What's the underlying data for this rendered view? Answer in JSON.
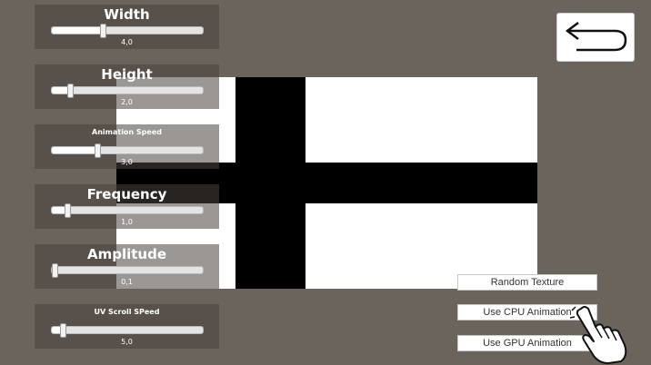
{
  "sliders": [
    {
      "title": "Width",
      "value": "4,0",
      "fraction": 0.34,
      "title_size": "big"
    },
    {
      "title": "Height",
      "value": "2,0",
      "fraction": 0.12,
      "title_size": "big"
    },
    {
      "title": "Animation Speed",
      "value": "3,0",
      "fraction": 0.3,
      "title_size": "small"
    },
    {
      "title": "Frequency",
      "value": "1,0",
      "fraction": 0.1,
      "title_size": "big"
    },
    {
      "title": "Amplitude",
      "value": "0,1",
      "fraction": 0.02,
      "title_size": "big"
    },
    {
      "title": "UV Scroll SPeed",
      "value": "5,0",
      "fraction": 0.07,
      "title_size": "small"
    }
  ],
  "buttons": {
    "random_texture": "Random Texture",
    "use_cpu": "Use CPU Animation",
    "use_gpu": "Use GPU Animation"
  },
  "icons": {
    "back": "undo-arrow-icon",
    "cursor": "hand-pointer-icon"
  },
  "colors": {
    "background": "#6b645d",
    "panel": "#48423c",
    "texture_light": "#ffffff",
    "texture_dark": "#000000"
  }
}
